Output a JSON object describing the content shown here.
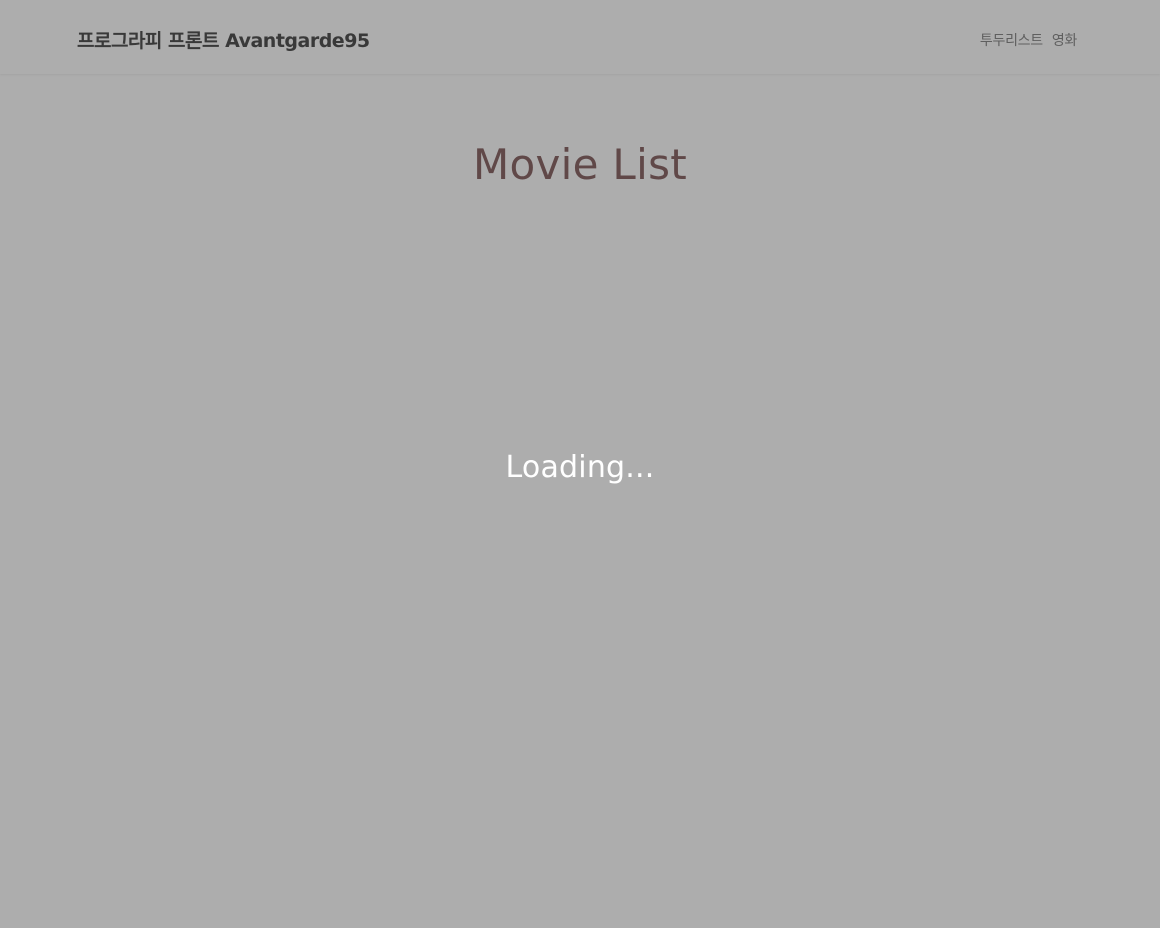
{
  "header": {
    "brand": "프로그라피 프론트 Avantgarde95",
    "nav": [
      {
        "label": "투두리스트"
      },
      {
        "label": "영화"
      }
    ]
  },
  "main": {
    "title": "Movie List"
  },
  "overlay": {
    "loading_text": "Loading..."
  },
  "colors": {
    "title": "#8e6b6b",
    "overlay": "rgba(0,0,0,0.32)",
    "loading_text": "#ffffff"
  }
}
